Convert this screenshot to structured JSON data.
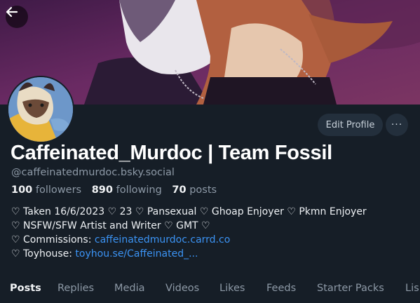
{
  "profile": {
    "display_name": "Caffeinated_Murdoc | Team Fossil",
    "handle": "@caffeinatedmurdoc.bsky.social",
    "followers_count": "100",
    "followers_label": "followers",
    "following_count": "890",
    "following_label": "following",
    "posts_count": "70",
    "posts_label": "posts"
  },
  "actions": {
    "edit_label": "Edit Profile",
    "more_label": "···"
  },
  "bio": {
    "line1": "♡ Taken 16/6/2023 ♡ 23 ♡ Pansexual ♡ Ghoap Enjoyer ♡ Pkmn Enjoyer",
    "line2": "♡  NSFW/SFW Artist and Writer ♡ GMT ♡",
    "line3_prefix": "♡ Commissions: ",
    "line3_link": "caffeinatedmurdoc.carrd.co",
    "line4_prefix": "♡ Toyhouse: ",
    "line4_link": "toyhou.se/Caffeinated_..."
  },
  "tabs": [
    "Posts",
    "Replies",
    "Media",
    "Videos",
    "Likes",
    "Feeds",
    "Starter Packs",
    "Lis"
  ],
  "colors": {
    "background": "#161e27",
    "link": "#3b93f4",
    "muted": "#8d99a6",
    "button_bg": "#232f3c"
  }
}
